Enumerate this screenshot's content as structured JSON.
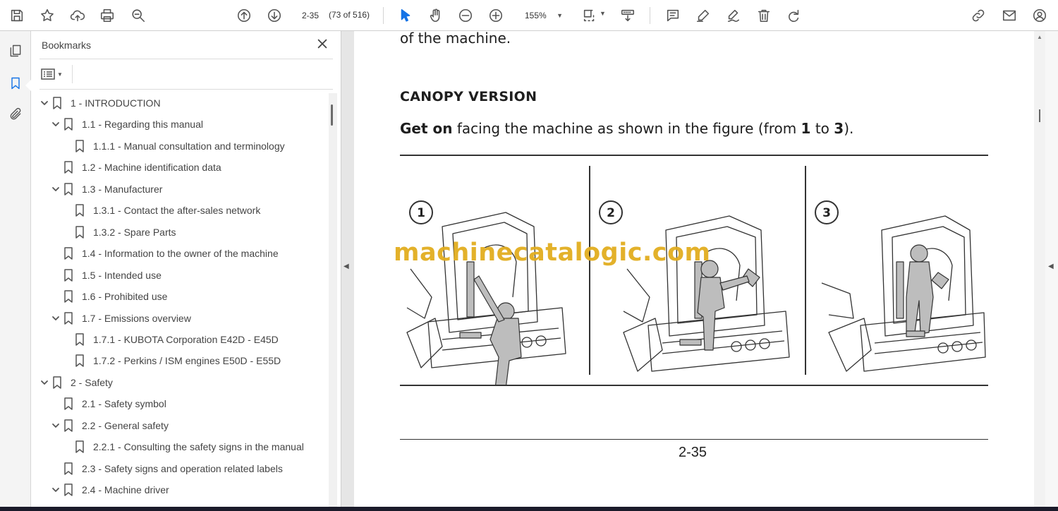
{
  "toolbar": {
    "page_value": "2-35",
    "page_count": "(73 of 516)",
    "zoom": "155%",
    "icons": [
      "save-icon",
      "star-icon",
      "upload-cloud-icon",
      "print-icon",
      "zoom-search-icon",
      "arrow-up-circle-icon",
      "arrow-down-circle-icon",
      "zoom-out-icon",
      "zoom-in-icon",
      "fit-page-icon",
      "scroll-mode-icon",
      "comment-icon",
      "highlight-pen-icon",
      "sign-icon",
      "delete-icon",
      "redo-icon",
      "link-icon",
      "mail-icon",
      "account-icon"
    ]
  },
  "left_rail": {
    "icons": [
      "pages-icon",
      "bookmark-icon",
      "attachment-icon"
    ],
    "active": "bookmark-icon"
  },
  "bookmarks_panel": {
    "title": "Bookmarks",
    "items": [
      {
        "level": 0,
        "expanded": true,
        "label": "1 -  INTRODUCTION"
      },
      {
        "level": 1,
        "expanded": true,
        "label": "1.1 - Regarding this manual"
      },
      {
        "level": 2,
        "expanded": null,
        "label": "1.1.1 - Manual consultation and terminology"
      },
      {
        "level": 1,
        "expanded": null,
        "label": "1.2 - Machine identification data"
      },
      {
        "level": 1,
        "expanded": true,
        "label": "1.3 - Manufacturer"
      },
      {
        "level": 2,
        "expanded": null,
        "label": "1.3.1 - Contact the after-sales network"
      },
      {
        "level": 2,
        "expanded": null,
        "label": "1.3.2 - Spare Parts"
      },
      {
        "level": 1,
        "expanded": null,
        "label": "1.4 - Information to the owner of the machine"
      },
      {
        "level": 1,
        "expanded": null,
        "label": "1.5 - Intended use"
      },
      {
        "level": 1,
        "expanded": null,
        "label": "1.6 - Prohibited use"
      },
      {
        "level": 1,
        "expanded": true,
        "label": "1.7 - Emissions overview"
      },
      {
        "level": 2,
        "expanded": null,
        "label": "1.7.1 - KUBOTA Corporation E42D - E45D"
      },
      {
        "level": 2,
        "expanded": null,
        "label": "1.7.2 - Perkins / ISM engines E50D - E55D"
      },
      {
        "level": 0,
        "expanded": true,
        "label": "2 -  Safety"
      },
      {
        "level": 1,
        "expanded": null,
        "label": "2.1 - Safety symbol"
      },
      {
        "level": 1,
        "expanded": true,
        "label": "2.2 - General safety"
      },
      {
        "level": 2,
        "expanded": null,
        "label": "2.2.1 - Consulting the safety signs in the manual"
      },
      {
        "level": 1,
        "expanded": null,
        "label": "2.3 - Safety signs and operation related labels"
      },
      {
        "level": 1,
        "expanded": true,
        "label": "2.4 - Machine driver"
      }
    ]
  },
  "document": {
    "continuation": "of the machine.",
    "heading": "CANOPY VERSION",
    "instruction": {
      "bold_start": "Get on",
      "middle": " facing the machine as shown in the figure (from ",
      "n1": "1",
      "to": " to ",
      "n2": "3",
      "end": ")."
    },
    "figure_steps": [
      "1",
      "2",
      "3"
    ],
    "page_number": "2-35",
    "watermark": "machinecatalogic.com"
  },
  "colors": {
    "accent": "#1473e6",
    "watermark": "#e2ad1f"
  }
}
